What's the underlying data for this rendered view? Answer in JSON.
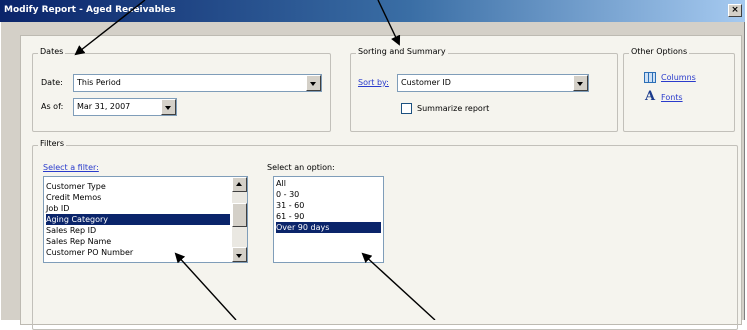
{
  "window": {
    "title": "Modify Report - Aged Receivables",
    "close_label": "×"
  },
  "dates": {
    "legend": "Dates",
    "date_label": "Date:",
    "date_value": "This Period",
    "asof_label": "As of:",
    "asof_value": "Mar 31, 2007"
  },
  "sorting": {
    "legend": "Sorting and Summary",
    "sortby_label": "Sort by:",
    "sortby_value": "Customer ID",
    "summarize_label": "Summarize report",
    "summarize_checked": false
  },
  "other": {
    "legend": "Other Options",
    "columns_label": "Columns",
    "fonts_label": "Fonts",
    "columns_icon": "columns-icon",
    "fonts_icon": "fonts-icon"
  },
  "filters": {
    "legend": "Filters",
    "select_filter_label": "Select a filter:",
    "filter_items": [
      "Customer Type",
      "Credit Memos",
      "Job ID",
      "Aging Category",
      "Sales Rep ID",
      "Sales Rep Name",
      "Customer PO Number"
    ],
    "selected_filter": "Aging Category",
    "select_option_label": "Select an option:",
    "option_items": [
      "All",
      "0 - 30",
      "31 - 60",
      "61 - 90",
      "Over 90 days"
    ],
    "selected_option": "Over 90 days"
  },
  "colors": {
    "title_start": "#0a246a",
    "title_end": "#a6caf0",
    "selection": "#0a246a",
    "link": "#2a3bcc"
  }
}
